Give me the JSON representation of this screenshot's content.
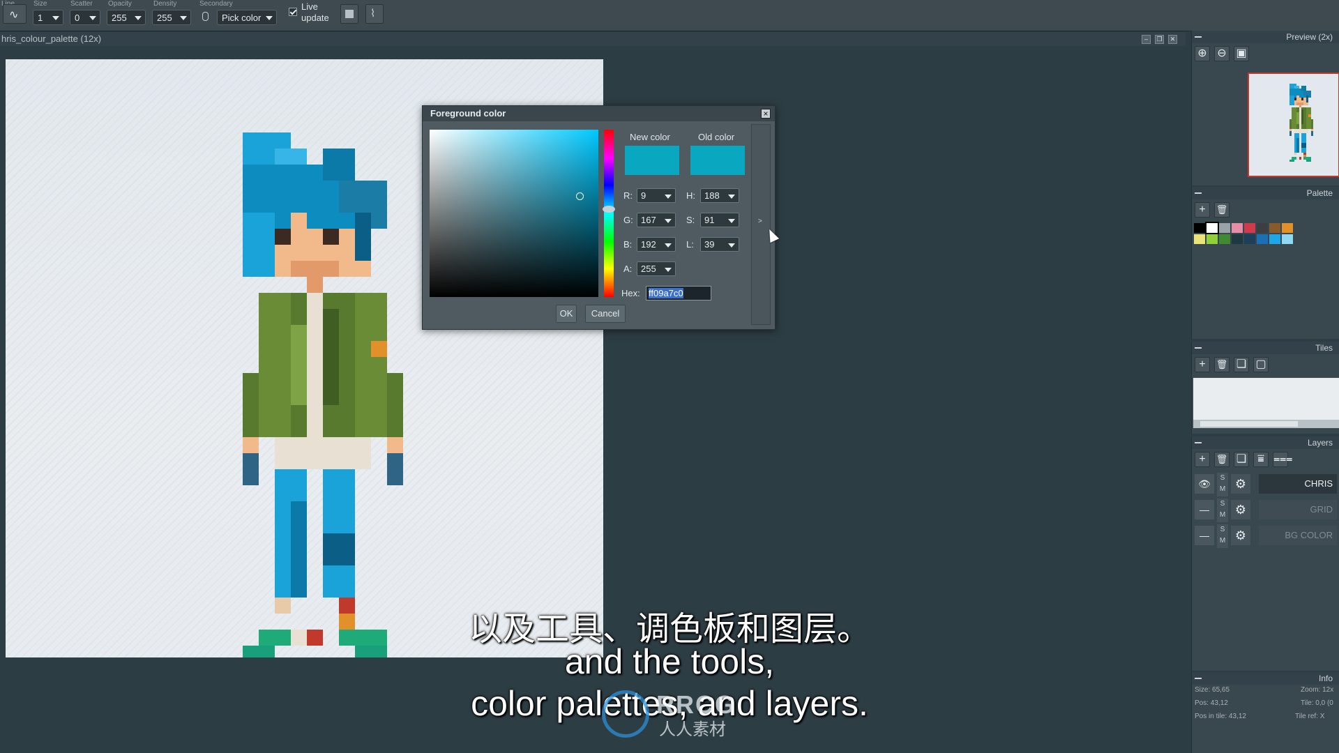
{
  "toolbar": {
    "line_label": "Line",
    "size": {
      "label": "Size",
      "value": "1"
    },
    "scatter": {
      "label": "Scatter",
      "value": "0"
    },
    "opacity": {
      "label": "Opacity",
      "value": "255"
    },
    "density": {
      "label": "Density",
      "value": "255"
    },
    "secondary": {
      "label": "Secondary",
      "value": "Pick color"
    },
    "live_update": {
      "line1": "Live",
      "line2": "update",
      "checked": true
    }
  },
  "document": {
    "title": "hris_colour_palette  (12x)"
  },
  "dialog": {
    "title": "Foreground color",
    "new_color_label": "New color",
    "old_color_label": "Old color",
    "new_color": "#09a7c0",
    "old_color": "#09a7c0",
    "r": {
      "label": "R:",
      "value": "9"
    },
    "g": {
      "label": "G:",
      "value": "167"
    },
    "b": {
      "label": "B:",
      "value": "192"
    },
    "a": {
      "label": "A:",
      "value": "255"
    },
    "h": {
      "label": "H:",
      "value": "188"
    },
    "s": {
      "label": "S:",
      "value": "91"
    },
    "l": {
      "label": "L:",
      "value": "39"
    },
    "hex": {
      "label": "Hex:",
      "value": "ff09a7c0"
    },
    "ok": "OK",
    "cancel": "Cancel",
    "expand": ">"
  },
  "panels": {
    "preview": {
      "title": "Preview (2x)"
    },
    "palette": {
      "title": "Palette",
      "colors": [
        "#000000",
        "#ffffff",
        "#9aa3a8",
        "#e58fa6",
        "#cf3b4a",
        "#3b3f42",
        "#8a5b2a",
        "#e2912a",
        "#e9e37a",
        "#8fcf3a",
        "#3f8a32",
        "#1e3a40",
        "#1d3f5a",
        "#1a6fb5",
        "#1fa6e6",
        "#8fd8f2"
      ]
    },
    "tiles": {
      "title": "Tiles"
    },
    "layers": {
      "title": "Layers",
      "items": [
        {
          "name": "CHRIS",
          "visible": true
        },
        {
          "name": "GRID",
          "visible": false
        },
        {
          "name": "BG COLOR",
          "visible": false
        }
      ],
      "s": "S",
      "m": "M"
    },
    "info": {
      "title": "Info",
      "size": "Size: 65,65",
      "pos": "Pos: 43,12",
      "pos_in_tile": "Pos in tile: 43,12",
      "zoom": "Zoom: 12x",
      "tile": "Tile: 0,0 (0",
      "tile_ref": "Tile ref: X"
    }
  },
  "subtitles": {
    "cn": "以及工具、调色板和图层。",
    "en1": "and the tools,",
    "en2": "color palettes, and layers."
  },
  "watermark": {
    "logo": "RRCG",
    "sub": "人人素材"
  }
}
